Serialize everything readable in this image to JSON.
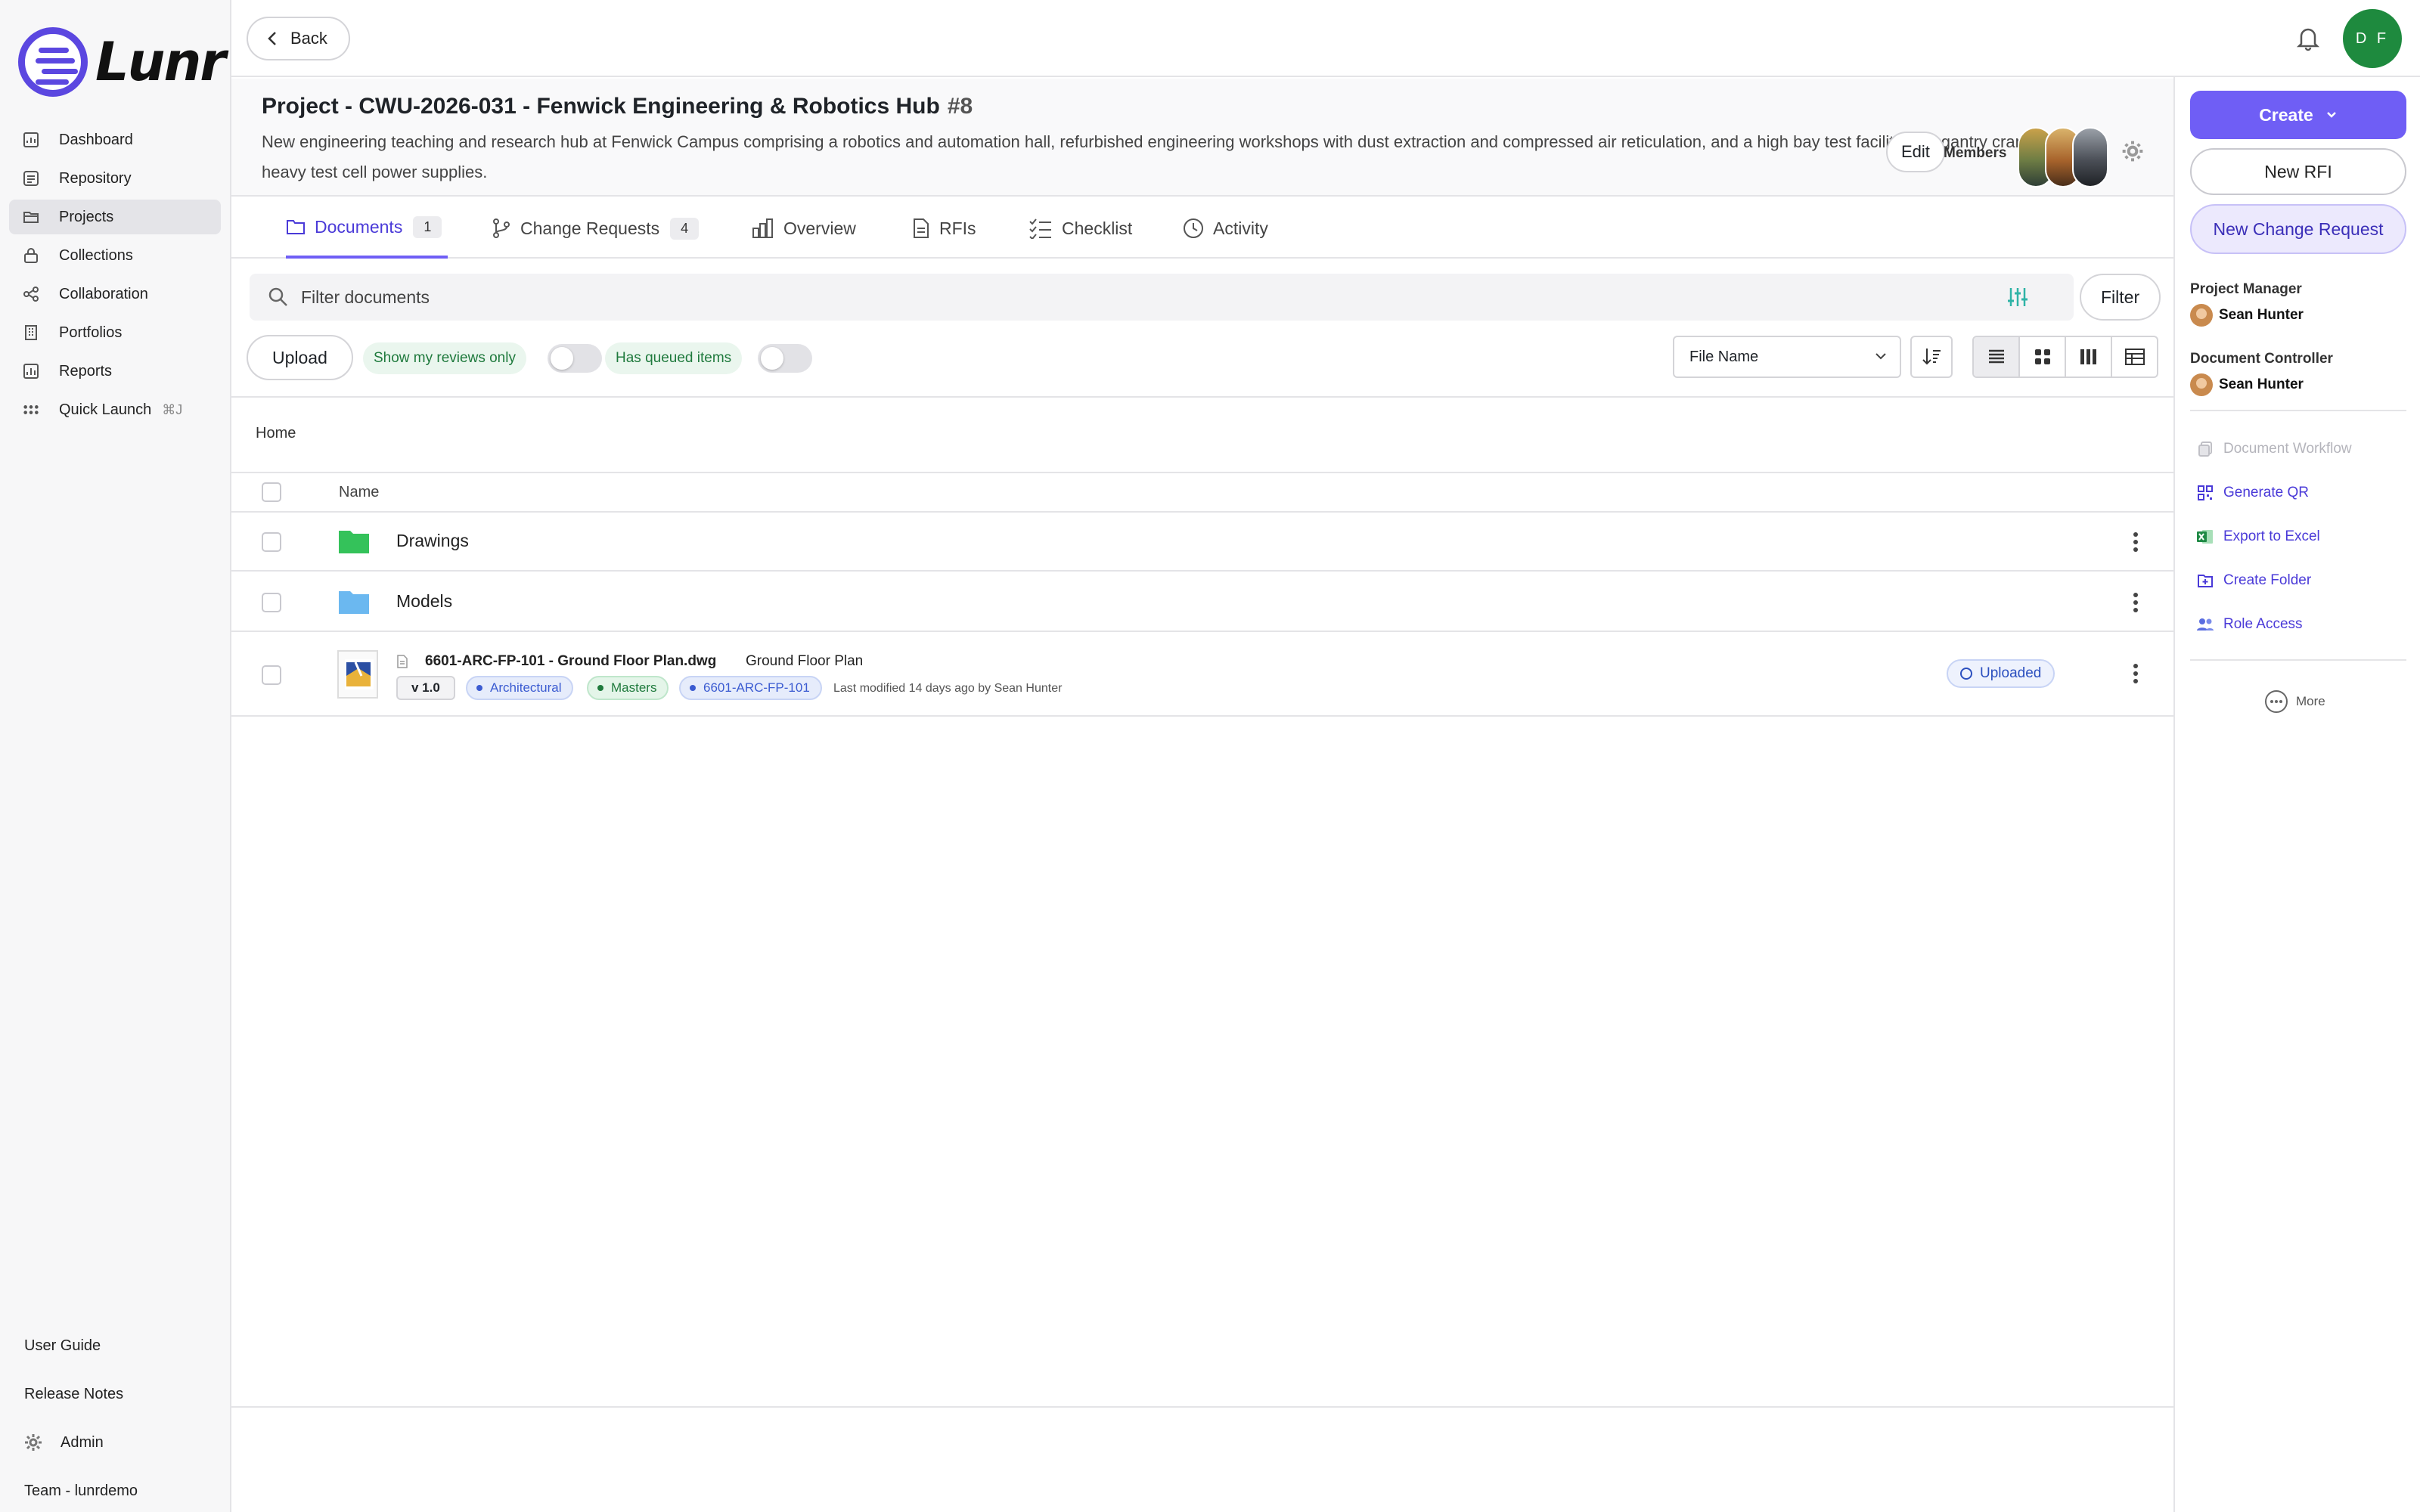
{
  "app": {
    "brand": "Lunr",
    "accent": "#6f5ef5"
  },
  "sidebar": {
    "items": [
      {
        "label": "Dashboard",
        "icon": "dashboard-icon"
      },
      {
        "label": "Repository",
        "icon": "repository-icon"
      },
      {
        "label": "Projects",
        "icon": "folder-icon",
        "active": true
      },
      {
        "label": "Collections",
        "icon": "lock-icon"
      },
      {
        "label": "Collaboration",
        "icon": "share-icon"
      },
      {
        "label": "Portfolios",
        "icon": "building-icon"
      },
      {
        "label": "Reports",
        "icon": "chart-icon"
      },
      {
        "label": "Quick Launch",
        "icon": "grid-dots-icon",
        "shortcut": "⌘J"
      }
    ],
    "bottom": {
      "user_guide": "User Guide",
      "release_notes": "Release Notes",
      "admin": "Admin",
      "team": "Team - lunrdemo"
    }
  },
  "topbar": {
    "back_label": "Back",
    "user_initials": "D F"
  },
  "project": {
    "title": "Project - CWU-2026-031 - Fenwick Engineering & Robotics Hub",
    "number": "#8",
    "description": "New engineering teaching and research hub at Fenwick Campus comprising a robotics and automation hall, refurbished engineering workshops with dust extraction and compressed air reticulation, and a high bay test facility with gantry crane and heavy test cell power supplies.",
    "edit_label": "Edit",
    "members_label": "Members"
  },
  "tabs": [
    {
      "label": "Documents",
      "count": "1",
      "active": true
    },
    {
      "label": "Change Requests",
      "count": "4"
    },
    {
      "label": "Overview"
    },
    {
      "label": "RFIs"
    },
    {
      "label": "Checklist"
    },
    {
      "label": "Activity"
    }
  ],
  "filter": {
    "placeholder": "Filter documents",
    "button_label": "Filter"
  },
  "toolbar": {
    "upload_label": "Upload",
    "reviews_toggle_label": "Show my reviews only",
    "queued_toggle_label": "Has queued items",
    "sort_field": "File Name"
  },
  "table": {
    "breadcrumb": "Home",
    "name_header": "Name",
    "folders": [
      {
        "name": "Drawings",
        "color": "#34c25a"
      },
      {
        "name": "Models",
        "color": "#6bb8f0"
      }
    ],
    "files": [
      {
        "filename": "6601-ARC-FP-101 - Ground Floor Plan.dwg",
        "title": "Ground Floor Plan",
        "version": "v 1.0",
        "tags": [
          {
            "label": "Architectural",
            "color": "#3b5bd1",
            "bg": "#e6ecfb"
          },
          {
            "label": "Masters",
            "color": "#1f7a3d",
            "bg": "#e4f5e9"
          },
          {
            "label": "6601-ARC-FP-101",
            "color": "#3b5bd1",
            "bg": "#e6ecfb"
          }
        ],
        "modified": "Last modified 14 days ago by Sean Hunter",
        "status": "Uploaded"
      }
    ]
  },
  "right_panel": {
    "create_label": "Create",
    "new_rfi_label": "New RFI",
    "new_cr_label": "New Change Request",
    "project_manager_label": "Project Manager",
    "project_manager": "Sean Hunter",
    "document_controller_label": "Document Controller",
    "document_controller": "Sean Hunter",
    "actions": [
      {
        "label": "Document Workflow",
        "icon": "copy-icon",
        "disabled": true
      },
      {
        "label": "Generate QR",
        "icon": "qr-icon"
      },
      {
        "label": "Export to Excel",
        "icon": "excel-icon"
      },
      {
        "label": "Create Folder",
        "icon": "folder-plus-icon"
      },
      {
        "label": "Role Access",
        "icon": "users-icon"
      }
    ],
    "more_label": "More"
  }
}
